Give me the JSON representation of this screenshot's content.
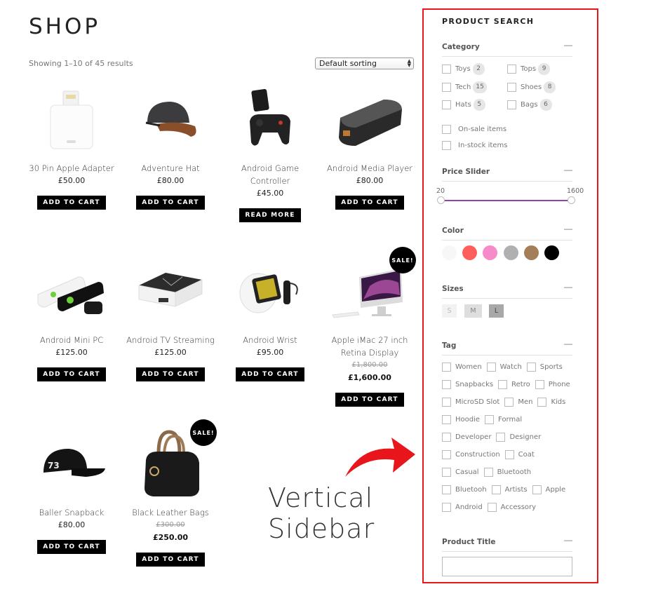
{
  "page": {
    "title": "SHOP",
    "result_count": "Showing 1–10 of 45 results",
    "sorting": {
      "selected": "Default sorting"
    }
  },
  "products": [
    {
      "name": "30 Pin Apple Adapter",
      "price": "£50.00",
      "button": "ADD TO CART",
      "icon": "adapter-image"
    },
    {
      "name": "Adventure Hat",
      "price": "£80.00",
      "button": "ADD TO CART",
      "icon": "cap-image"
    },
    {
      "name": "Android Game Controller",
      "price": "£45.00",
      "button": "READ MORE",
      "icon": "gamepad-image"
    },
    {
      "name": "Android Media Player",
      "price": "£80.00",
      "button": "ADD TO CART",
      "icon": "media-player-image"
    },
    {
      "name": "Android Mini PC",
      "price": "£125.00",
      "button": "ADD TO CART",
      "icon": "mini-pc-image"
    },
    {
      "name": "Android TV Streaming",
      "price": "£125.00",
      "button": "ADD TO CART",
      "icon": "tv-box-image"
    },
    {
      "name": "Android Wrist",
      "price": "£95.00",
      "button": "ADD TO CART",
      "icon": "smartwatch-image"
    },
    {
      "name": "Apple iMac 27 inch Retina Display",
      "old_price": "£1,800.00",
      "price": "£1,600.00",
      "button": "ADD TO CART",
      "sale": "SALE!",
      "icon": "imac-image"
    },
    {
      "name": "Baller Snapback",
      "price": "£80.00",
      "button": "ADD TO CART",
      "icon": "snapback-image"
    },
    {
      "name": "Black Leather Bags",
      "old_price": "£300.00",
      "price": "£250.00",
      "button": "ADD TO CART",
      "sale": "SALE!",
      "icon": "handbag-image"
    }
  ],
  "sidebar": {
    "title": "PRODUCT SEARCH",
    "collapse_symbol": "—",
    "category": {
      "heading": "Category",
      "items": [
        {
          "label": "Toys",
          "count": "2"
        },
        {
          "label": "Tops",
          "count": "9"
        },
        {
          "label": "Tech",
          "count": "15"
        },
        {
          "label": "Shoes",
          "count": "8"
        },
        {
          "label": "Hats",
          "count": "5"
        },
        {
          "label": "Bags",
          "count": "6"
        }
      ],
      "extra": [
        "On-sale items",
        "In-stock items"
      ]
    },
    "price_slider": {
      "heading": "Price Slider",
      "min": "20",
      "max": "1600",
      "accent": "#8e44ad"
    },
    "color": {
      "heading": "Color",
      "swatches": [
        {
          "name": "white",
          "hex": "#f7f7f7"
        },
        {
          "name": "red",
          "hex": "#ff5f5a"
        },
        {
          "name": "pink",
          "hex": "#f78ac8"
        },
        {
          "name": "gray",
          "hex": "#b0b0b0"
        },
        {
          "name": "brown",
          "hex": "#a47e58"
        },
        {
          "name": "black",
          "hex": "#000000"
        }
      ]
    },
    "sizes": {
      "heading": "Sizes",
      "options": [
        "S",
        "M",
        "L"
      ]
    },
    "tag": {
      "heading": "Tag",
      "rows": [
        [
          "Women",
          "Watch",
          "Sports"
        ],
        [
          "Snapbacks",
          "Retro",
          "Phone"
        ],
        [
          "MicroSD Slot",
          "Men",
          "Kids"
        ],
        [
          "Hoodie",
          "Formal"
        ],
        [
          "Developer",
          "Designer"
        ],
        [
          "Construction",
          "Coat"
        ],
        [
          "Casual",
          "Bluetooth"
        ],
        [
          "Bluetooh",
          "Artists",
          "Apple"
        ],
        [
          "Android",
          "Accessory"
        ]
      ]
    },
    "product_title": {
      "heading": "Product Title",
      "value": ""
    }
  },
  "annotation": {
    "line1": "Vertical",
    "line2": "Sidebar",
    "color": "#e8151b"
  }
}
